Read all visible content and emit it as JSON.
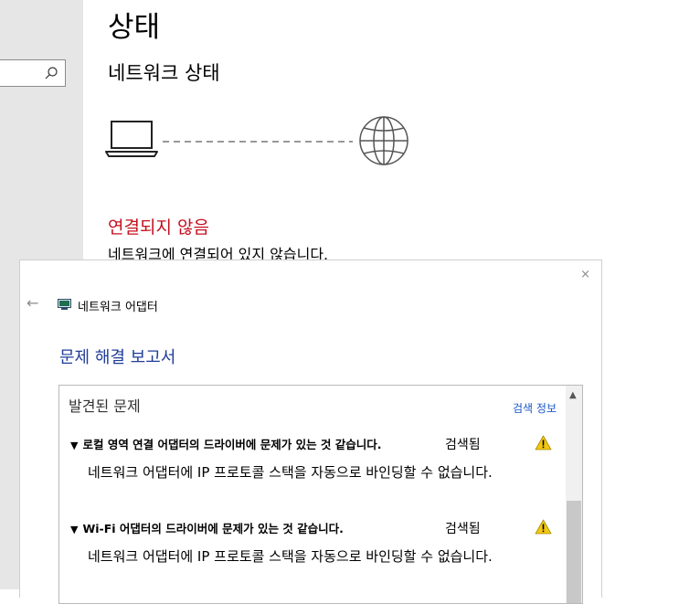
{
  "settings": {
    "page_title": "상태",
    "section_title": "네트워크 상태",
    "status": "연결되지 않음",
    "status_description": "네트워크에 연결되어 있지 않습니다."
  },
  "dialog": {
    "title": "네트워크 어댑터",
    "report_title": "문제 해결 보고서",
    "panel_header": "발견된 문제",
    "detail_link": "검색 정보",
    "close_glyph": "×",
    "back_glyph": "←",
    "problems": [
      {
        "title": "로컬 영역 연결 어댑터의 드라이버에 문제가 있는 것 같습니다.",
        "status": "검색됨",
        "description": "네트워크 어댑터에 IP 프로토콜 스택을 자동으로 바인딩할 수 없습니다."
      },
      {
        "title": "Wi-Fi 어댑터의 드라이버에 문제가 있는 것 같습니다.",
        "status": "검색됨",
        "description": "네트워크 어댑터에 IP 프로토콜 스택을 자동으로 바인딩할 수 없습니다."
      }
    ]
  },
  "colors": {
    "error": "#c50f1f",
    "link": "#1a56c9",
    "heading": "#1f3c99",
    "warning": "#f2c811"
  },
  "icons": {
    "search": "search-icon",
    "computer": "laptop-icon",
    "internet": "globe-icon",
    "adapter": "network-adapter-icon",
    "warning": "warning-icon"
  }
}
